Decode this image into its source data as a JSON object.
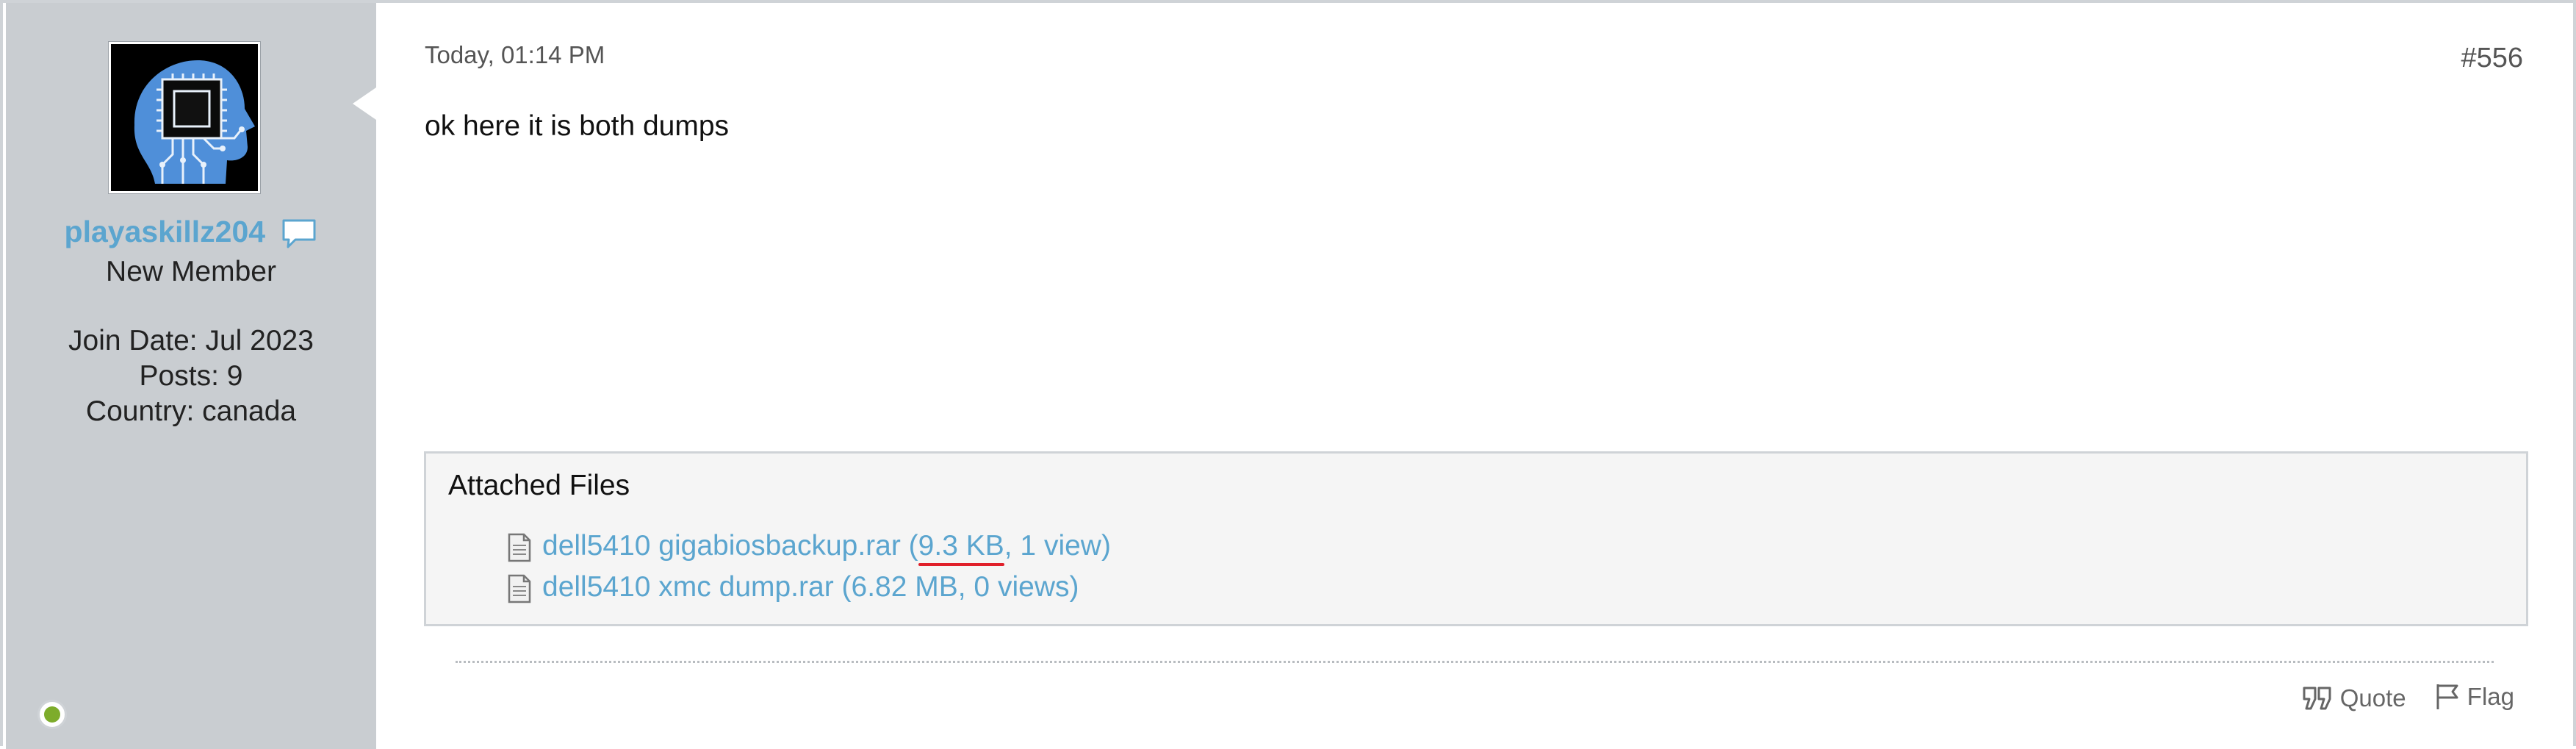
{
  "user": {
    "username": "playaskillz204",
    "title": "New Member",
    "join_date": "Join Date: Jul 2023",
    "posts": "Posts: 9",
    "country": "Country: canada",
    "avatar_icon": "head-chip-icon",
    "pm_icon": "speech-bubble-icon",
    "online_status_icon": "online-dot-icon"
  },
  "post": {
    "date": "Today, 01:14 PM",
    "number": "#556",
    "body": "ok here it is both dumps"
  },
  "attachments": {
    "heading": "Attached Files",
    "items": [
      {
        "name": "dell5410 gigabiosbackup.rar",
        "open": " (",
        "size": "9.3 KB",
        "rest": ", 1 view)",
        "icon": "file-icon"
      },
      {
        "name": "dell5410 xmc dump.rar",
        "open": " (",
        "size": "6.82 MB",
        "rest": ", 0 views)",
        "icon": "file-icon"
      }
    ]
  },
  "actions": {
    "quote_label": "Quote",
    "flag_label": "Flag",
    "quote_icon": "quote-icon",
    "flag_icon": "flag-icon"
  },
  "colors": {
    "link": "#5ba5cf",
    "sidebar": "#c9cdd1",
    "online": "#7dac2b",
    "highlight_underline": "#e0202a"
  }
}
